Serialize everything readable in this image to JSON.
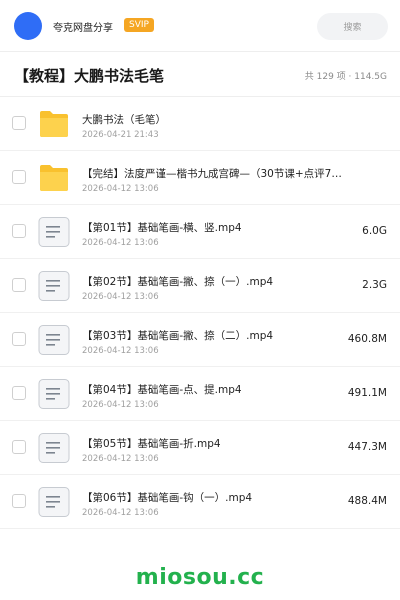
{
  "header": {
    "app_name": "夸克网盘分享",
    "badge": "SVIP",
    "search_label": "搜索",
    "avatar_color": "#2f6df6",
    "badge_color": "#f5a623"
  },
  "title_row": {
    "title": "【教程】大鹏书法毛笔",
    "summary": "共 129 项 · 114.5G"
  },
  "files": [
    {
      "type": "folder",
      "icon": "folder-icon",
      "name": "大鹏书法（毛笔）",
      "date": "2026-04-21 21:43",
      "size": ""
    },
    {
      "type": "folder",
      "icon": "folder-icon",
      "name": "【完结】法度严谨—楷书九成宫碑—（30节课+点评7…",
      "date": "2026-04-12 13:06",
      "size": ""
    },
    {
      "type": "file",
      "icon": "document-icon",
      "name": "【第01节】基础笔画-横、竖.mp4",
      "date": "2026-04-12 13:06",
      "size": "6.0G"
    },
    {
      "type": "file",
      "icon": "document-icon",
      "name": "【第02节】基础笔画-撇、捺（一）.mp4",
      "date": "2026-04-12 13:06",
      "size": "2.3G"
    },
    {
      "type": "file",
      "icon": "document-icon",
      "name": "【第03节】基础笔画-撇、捺（二）.mp4",
      "date": "2026-04-12 13:06",
      "size": "460.8M"
    },
    {
      "type": "file",
      "icon": "document-icon",
      "name": "【第04节】基础笔画-点、提.mp4",
      "date": "2026-04-12 13:06",
      "size": "491.1M"
    },
    {
      "type": "file",
      "icon": "document-icon",
      "name": "【第05节】基础笔画-折.mp4",
      "date": "2026-04-12 13:06",
      "size": "447.3M"
    },
    {
      "type": "file",
      "icon": "document-icon",
      "name": "【第06节】基础笔画-钩（一）.mp4",
      "date": "2026-04-12 13:06",
      "size": "488.4M"
    }
  ],
  "watermark": "miosou.cc",
  "colors": {
    "folder": "#f9c12e",
    "watermark": "#23b14d"
  }
}
